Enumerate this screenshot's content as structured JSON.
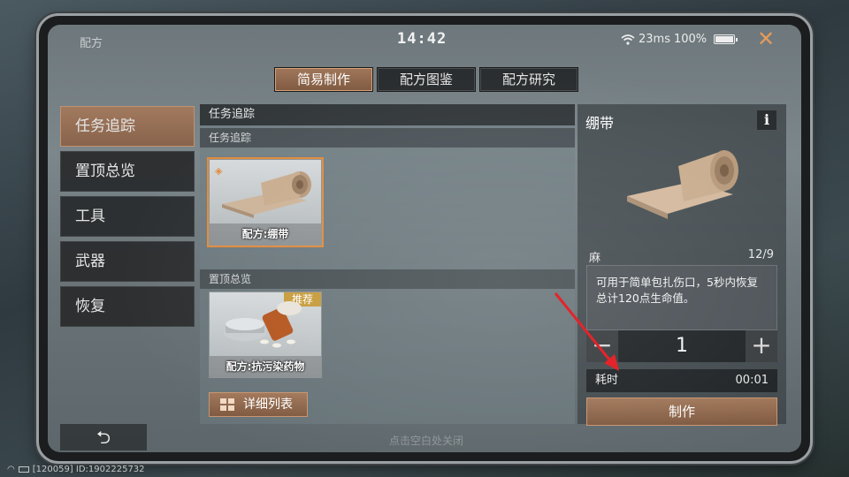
{
  "status": {
    "title": "配方",
    "clock": "14:42",
    "ping": "23ms",
    "battery": "100%"
  },
  "tabs": [
    {
      "label": "简易制作",
      "active": true
    },
    {
      "label": "配方图鉴",
      "active": false
    },
    {
      "label": "配方研究",
      "active": false
    }
  ],
  "sidebar": {
    "items": [
      {
        "label": "任务追踪",
        "active": true
      },
      {
        "label": "置顶总览",
        "active": false
      },
      {
        "label": "工具",
        "active": false
      },
      {
        "label": "武器",
        "active": false
      },
      {
        "label": "恢复",
        "active": false
      }
    ]
  },
  "center": {
    "header": "任务追踪",
    "sections": [
      {
        "title": "任务追踪",
        "cards": [
          {
            "label": "配方:绷带",
            "selected": true
          }
        ]
      },
      {
        "title": "置顶总览",
        "cards": [
          {
            "label": "配方:抗污染药物",
            "badge": "推荐"
          }
        ]
      }
    ],
    "list_button": "详细列表"
  },
  "detail": {
    "title": "绷带",
    "info": "i",
    "material": "麻",
    "material_count": "12/9",
    "description": "可用于简单包扎伤口，5秒内恢复总计120点生命值。",
    "quantity": "1",
    "time_label": "耗时",
    "time_value": "00:01",
    "craft_button": "制作"
  },
  "footer": {
    "back": "⮌",
    "hint": "点击空白处关闭"
  },
  "system": {
    "id_text": "[120059] ID:1902225732"
  },
  "colors": {
    "accent": "#a1775a",
    "close": "#e59b5b",
    "badge": "#c79b3c",
    "arrow": "#e3242b"
  }
}
